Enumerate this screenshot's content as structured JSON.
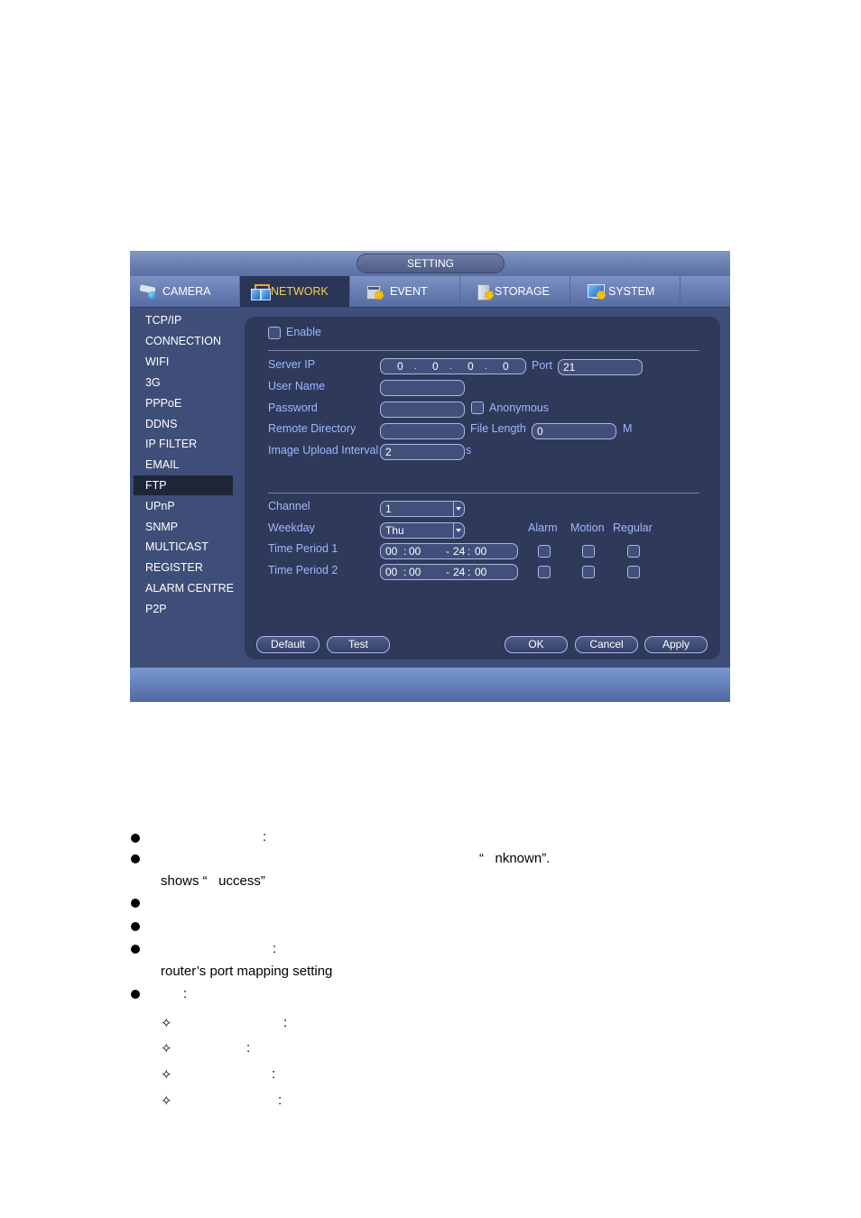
{
  "window": {
    "title": "SETTING"
  },
  "tabs": [
    {
      "label": "CAMERA",
      "icon": "camera-icon",
      "active": false
    },
    {
      "label": "NETWORK",
      "icon": "network-icon",
      "active": true
    },
    {
      "label": "EVENT",
      "icon": "event-icon",
      "active": false
    },
    {
      "label": "STORAGE",
      "icon": "storage-icon",
      "active": false
    },
    {
      "label": "SYSTEM",
      "icon": "system-icon",
      "active": false
    }
  ],
  "sidebar": {
    "items": [
      {
        "label": "TCP/IP"
      },
      {
        "label": "CONNECTION"
      },
      {
        "label": "WIFI"
      },
      {
        "label": "3G"
      },
      {
        "label": "PPPoE"
      },
      {
        "label": "DDNS"
      },
      {
        "label": "IP FILTER"
      },
      {
        "label": "EMAIL"
      },
      {
        "label": "FTP",
        "active": true
      },
      {
        "label": "UPnP"
      },
      {
        "label": "SNMP"
      },
      {
        "label": "MULTICAST"
      },
      {
        "label": "REGISTER"
      },
      {
        "label": "ALARM CENTRE"
      },
      {
        "label": "P2P"
      }
    ]
  },
  "ftp": {
    "enable_label": "Enable",
    "enabled": false,
    "server_ip_label": "Server IP",
    "server_ip": [
      "0",
      "0",
      "0",
      "0"
    ],
    "ip_separator": ".",
    "port_label": "Port",
    "port": "21",
    "user_name_label": "User Name",
    "user_name": "",
    "password_label": "Password",
    "password": "",
    "anonymous_label": "Anonymous",
    "anonymous": false,
    "remote_dir_label": "Remote Directory",
    "remote_dir": "",
    "file_length_label": "File Length",
    "file_length": "0",
    "file_length_unit": "M",
    "upload_interval_label": "Image Upload Interval",
    "upload_interval": "2",
    "upload_interval_unit": "s",
    "channel_label": "Channel",
    "channel": "1",
    "weekday_label": "Weekday",
    "weekday": "Thu",
    "col_alarm": "Alarm",
    "col_motion": "Motion",
    "col_regular": "Regular",
    "periods": [
      {
        "label": "Time Period 1",
        "start_h": "00",
        "start_m": "00",
        "end_h": "24",
        "end_m": "00",
        "alarm": false,
        "motion": false,
        "regular": false
      },
      {
        "label": "Time Period 2",
        "start_h": "00",
        "start_m": "00",
        "end_h": "24",
        "end_m": "00",
        "alarm": false,
        "motion": false,
        "regular": false
      }
    ],
    "time_sep": ":",
    "range_sep": "-"
  },
  "buttons": {
    "default": "Default",
    "test": "Test",
    "ok": "OK",
    "cancel": "Cancel",
    "apply": "Apply"
  },
  "document": {
    "line1_colon": ":",
    "line2_tail": "“   nknown”.",
    "line3": "shows “   uccess”",
    "line5_colon": ":",
    "line6": "router’s port mapping setting",
    "line7_colon": ":",
    "sub_colons": [
      ":",
      ":",
      ":",
      ":"
    ],
    "sub_bullet_glyph": "✧"
  }
}
